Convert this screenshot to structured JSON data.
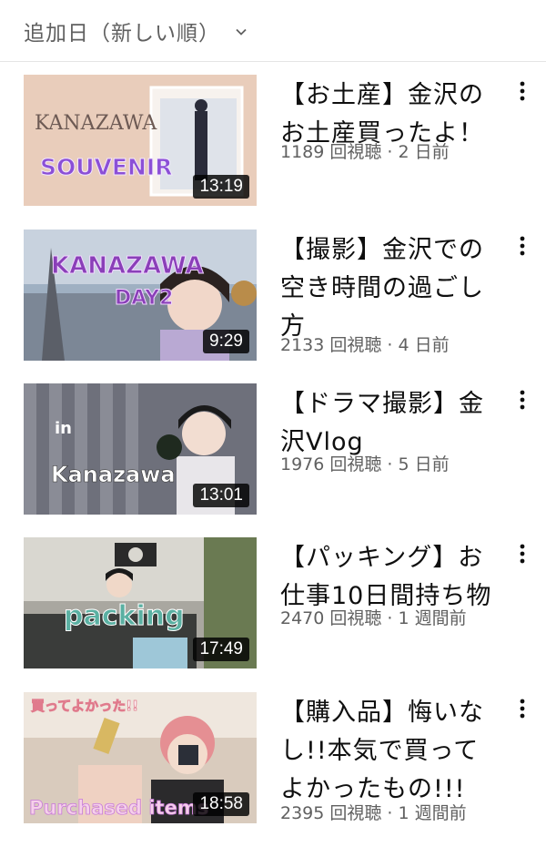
{
  "sort": {
    "label": "追加日（新しい順）",
    "chevron_icon": "chevron-down-icon"
  },
  "videos": [
    {
      "title": "【お土産】金沢のお土産買ったよ！",
      "meta": "1189 回視聴 · 2 日前",
      "duration": "13:19",
      "thumb_text_1": "KANAZAWA",
      "thumb_text_2": "SOUVENIR",
      "bg": "#e8c9b6"
    },
    {
      "title": "【撮影】金沢での空き時間の過ごし方",
      "meta": "2133 回視聴 · 4 日前",
      "duration": "9:29",
      "thumb_text_1": "KANAZAWA",
      "thumb_text_2": "DAY2",
      "bg": "#8aa0b8"
    },
    {
      "title": "【ドラマ撮影】金沢Vlog",
      "meta": "1976 回視聴 · 5 日前",
      "duration": "13:01",
      "thumb_text_1": "in",
      "thumb_text_2": "Kanazawa",
      "bg": "#6d6f7a"
    },
    {
      "title": "【パッキング】お仕事10日間持ち物",
      "meta": "2470 回視聴 · 1 週間前",
      "duration": "17:49",
      "thumb_text_1": "packing",
      "thumb_text_2": "",
      "bg": "#8a8f86"
    },
    {
      "title": "【購入品】悔いなし!!本気で買ってよかったもの!!!",
      "meta": "2395 回視聴 · 1 週間前",
      "duration": "18:58",
      "thumb_text_1": "買ってよかった!!",
      "thumb_text_2": "Purchased items",
      "bg": "#d8c9b8"
    }
  ]
}
